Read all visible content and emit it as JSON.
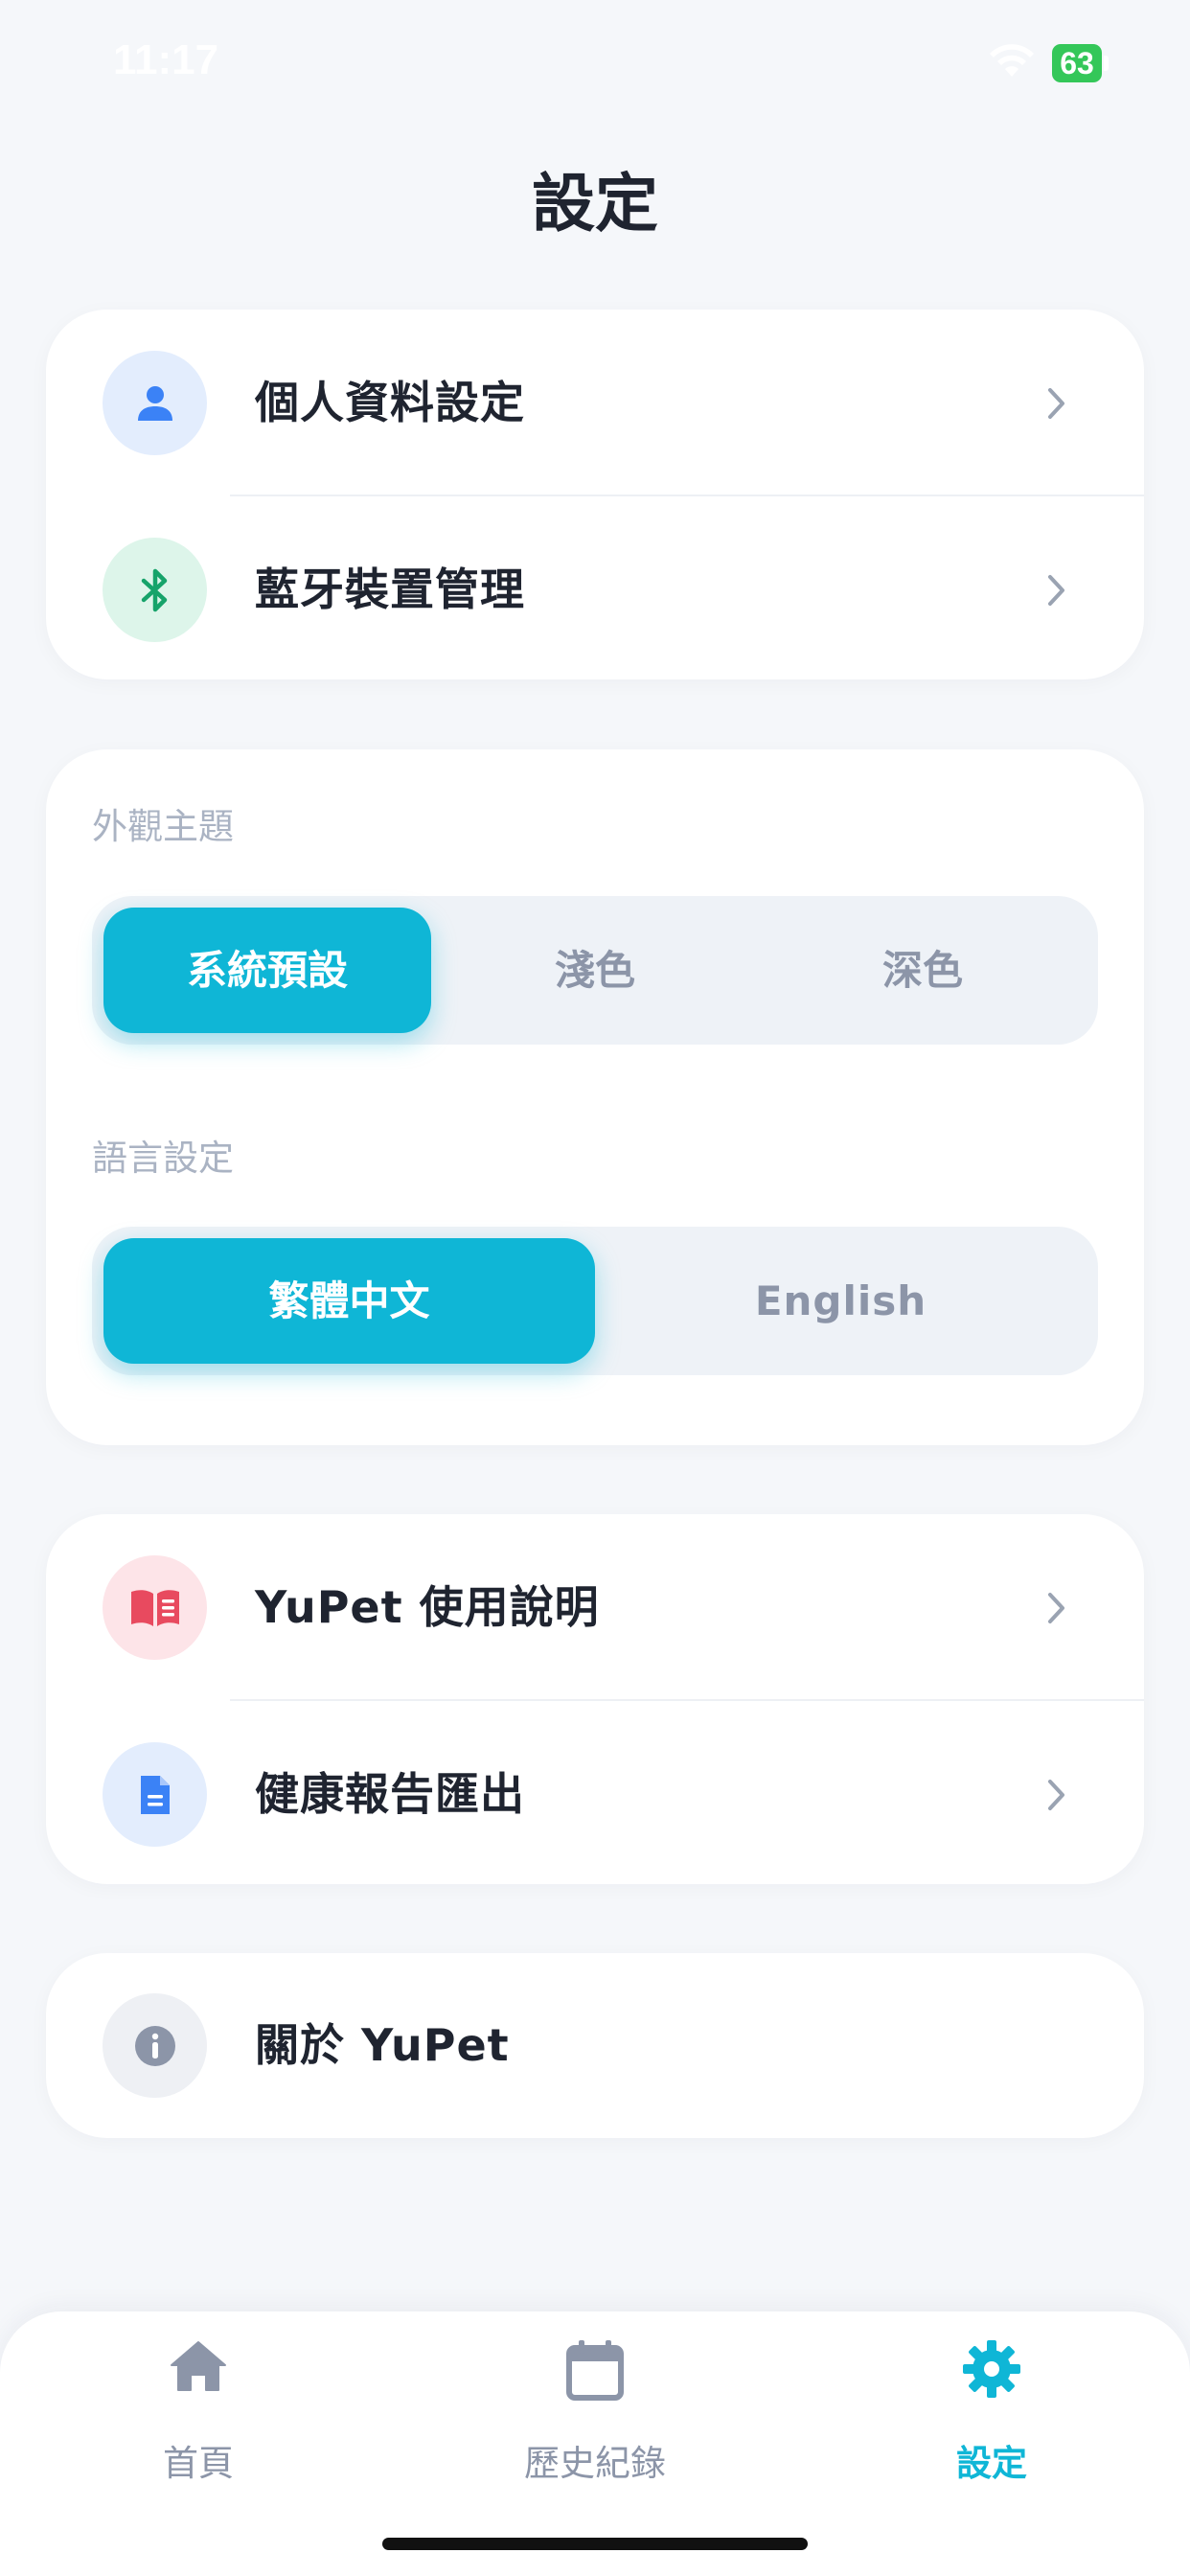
{
  "status_bar": {
    "time": "11:17",
    "battery": "63"
  },
  "header": {
    "title": "設定"
  },
  "account_card": {
    "items": [
      {
        "label": "個人資料設定",
        "icon": "person-icon"
      },
      {
        "label": "藍牙裝置管理",
        "icon": "bluetooth-icon"
      }
    ]
  },
  "preferences_card": {
    "appearance": {
      "label": "外觀主題",
      "options": [
        "系統預設",
        "淺色",
        "深色"
      ],
      "selected": "系統預設"
    },
    "language": {
      "label": "語言設定",
      "options": [
        "繁體中文",
        "English"
      ],
      "selected": "繁體中文"
    }
  },
  "info_card": {
    "items": [
      {
        "label": "YuPet 使用說明",
        "icon": "book-icon"
      },
      {
        "label": "健康報告匯出",
        "icon": "document-icon"
      }
    ]
  },
  "about_card": {
    "label": "關於 YuPet",
    "icon": "info-icon"
  },
  "tab_bar": {
    "items": [
      {
        "label": "首頁",
        "icon": "home-icon"
      },
      {
        "label": "歷史紀錄",
        "icon": "calendar-icon"
      },
      {
        "label": "設定",
        "icon": "gear-icon"
      }
    ],
    "active": "設定"
  },
  "colors": {
    "accent": "#0fb6d6",
    "background": "#f5f7fa",
    "card": "#ffffff",
    "muted_text": "#aab3c3"
  }
}
